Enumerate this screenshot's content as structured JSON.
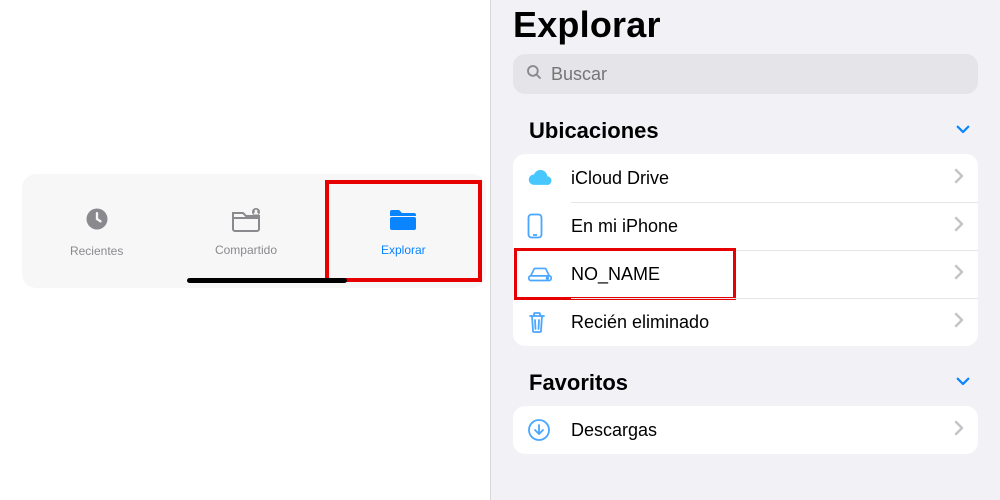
{
  "tabs": {
    "recent": {
      "label": "Recientes"
    },
    "shared": {
      "label": "Compartido"
    },
    "browse": {
      "label": "Explorar"
    }
  },
  "browse": {
    "title": "Explorar",
    "search_placeholder": "Buscar",
    "sections": {
      "locations": {
        "title": "Ubicaciones",
        "items": {
          "icloud": {
            "label": "iCloud Drive"
          },
          "iphone": {
            "label": "En mi iPhone"
          },
          "drive": {
            "label": "NO_NAME"
          },
          "trash": {
            "label": "Recién eliminado"
          }
        }
      },
      "favorites": {
        "title": "Favoritos",
        "items": {
          "downloads": {
            "label": "Descargas"
          }
        }
      }
    }
  },
  "colors": {
    "accent": "#0a84ff",
    "muted": "#8a8a8e",
    "highlight_red": "#e60000"
  }
}
